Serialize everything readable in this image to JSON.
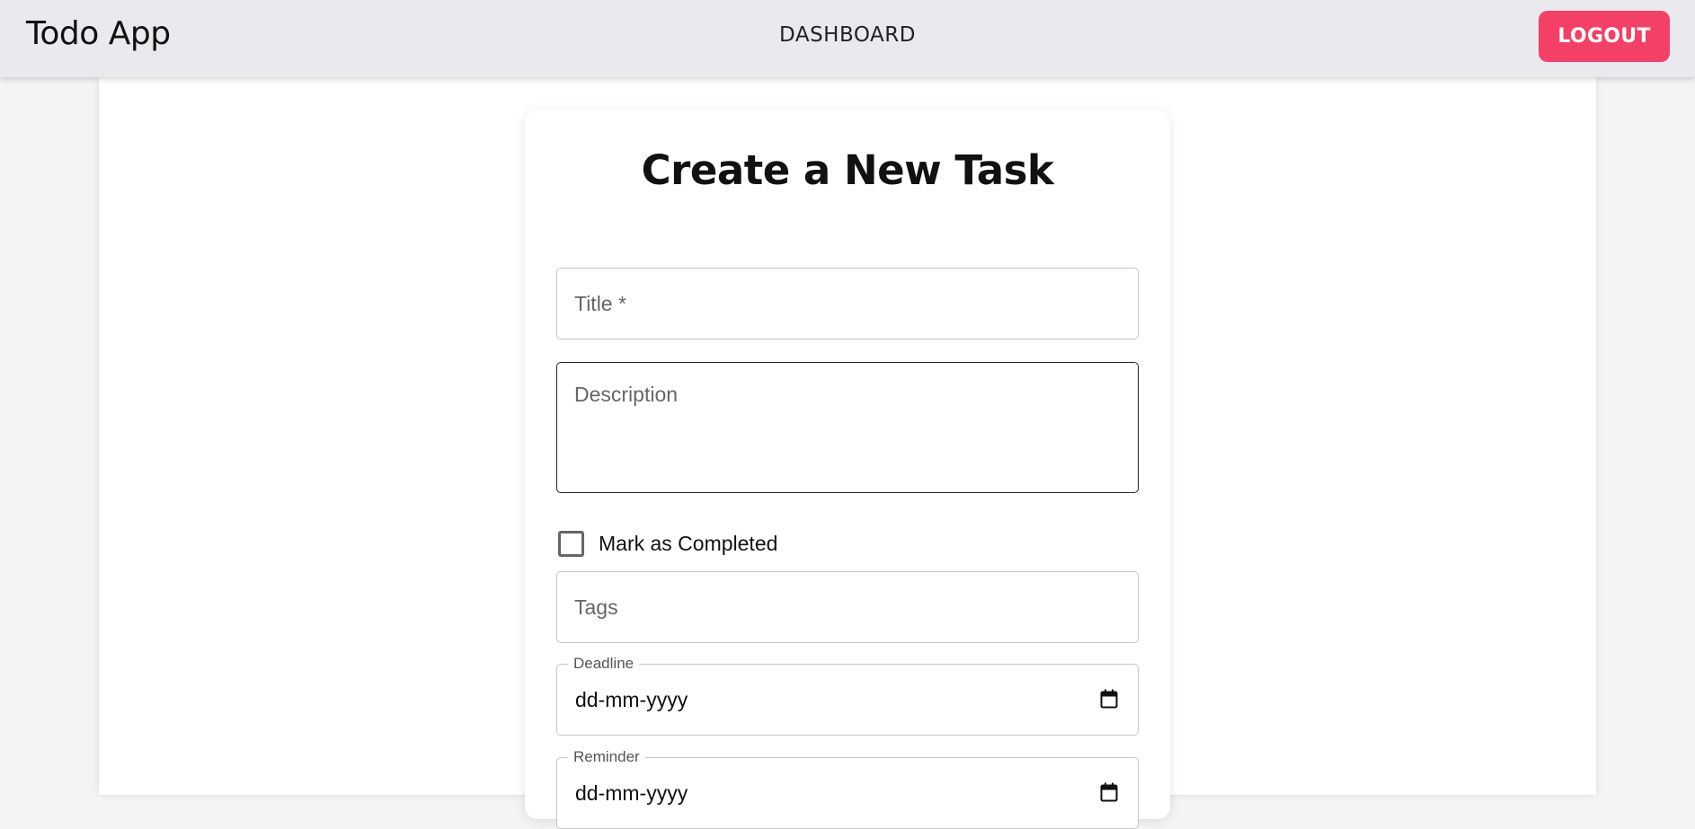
{
  "navbar": {
    "brand": "Todo App",
    "center_link": "DASHBOARD",
    "logout_label": "LOGOUT",
    "accent_color": "#f43f66"
  },
  "form": {
    "heading": "Create a New Task",
    "title_placeholder": "Title *",
    "description_placeholder": "Description",
    "completed_label": "Mark as Completed",
    "completed_checked": false,
    "tags_placeholder": "Tags",
    "deadline": {
      "label": "Deadline",
      "value": "dd-mm-yyyy",
      "icon": "calendar-icon"
    },
    "reminder": {
      "label": "Reminder",
      "value": "dd-mm-yyyy",
      "icon": "calendar-icon"
    }
  }
}
